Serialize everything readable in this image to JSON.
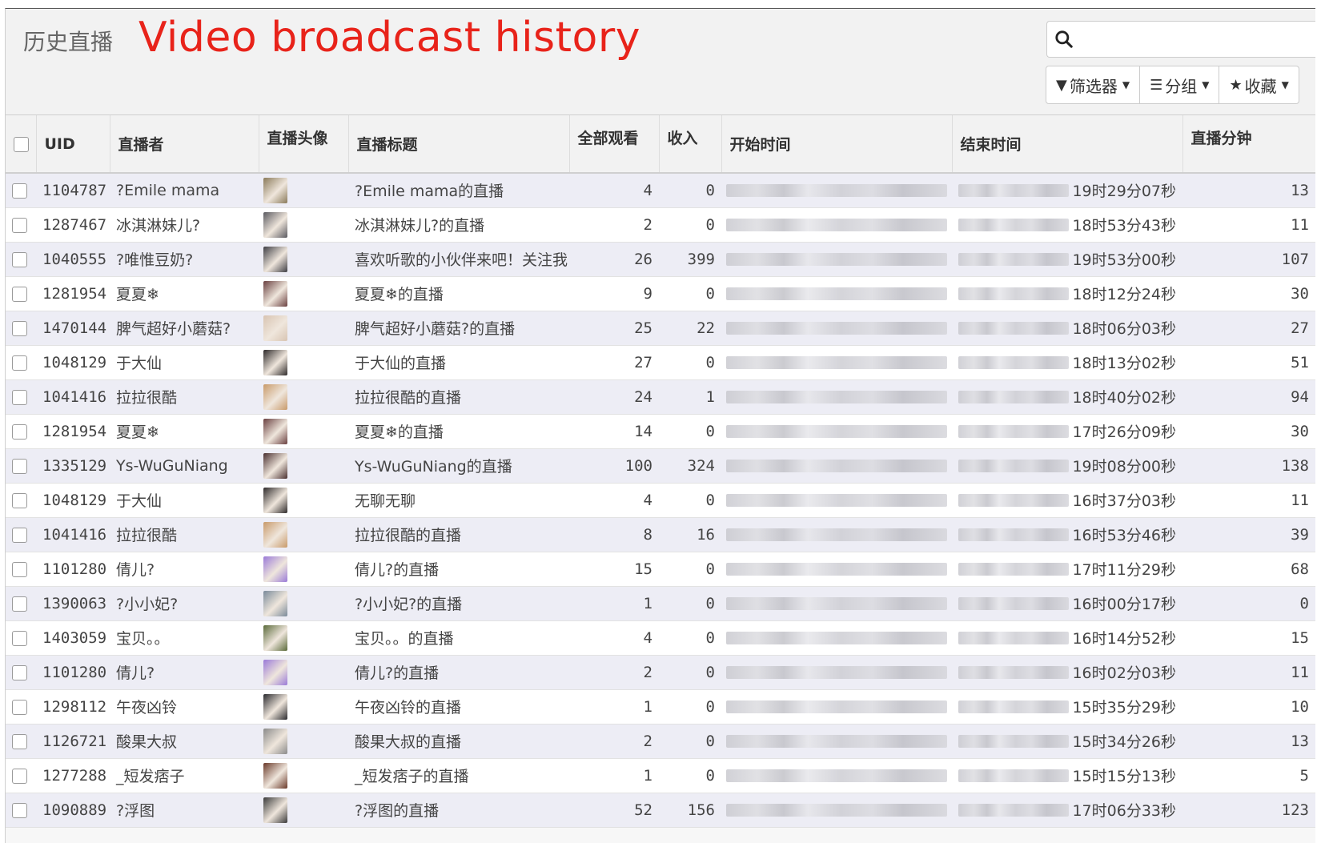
{
  "header": {
    "breadcrumb": "历史直播",
    "title": "Video broadcast history",
    "search": {
      "placeholder": ""
    },
    "buttons": [
      {
        "icon": "filter-icon",
        "label": "筛选器"
      },
      {
        "icon": "list-icon",
        "label": "分组"
      },
      {
        "icon": "star-icon",
        "label": "收藏"
      }
    ]
  },
  "table": {
    "columns": [
      "UID",
      "直播者",
      "直播头像",
      "直播标题",
      "全部观看",
      "收入",
      "开始时间",
      "结束时间",
      "直播分钟"
    ],
    "rows": [
      {
        "uid": "1104787",
        "streamer": "?Emile mama",
        "title": "?Emile mama的直播",
        "views": "4",
        "income": "0",
        "end": "19时29分07秒",
        "minutes": "13",
        "avatar_color": "#8a7a5a"
      },
      {
        "uid": "1287467",
        "streamer": "冰淇淋妹儿?",
        "title": "冰淇淋妹儿?的直播",
        "views": "2",
        "income": "0",
        "end": "18时53分43秒",
        "minutes": "11",
        "avatar_color": "#5a5a60"
      },
      {
        "uid": "1040555",
        "streamer": "?唯惟豆奶?",
        "title": "喜欢听歌的小伙伴来吧！关注我",
        "views": "26",
        "income": "399",
        "end": "19时53分00秒",
        "minutes": "107",
        "avatar_color": "#3e3e44"
      },
      {
        "uid": "1281954",
        "streamer": "夏夏❄",
        "title": "夏夏❄的直播",
        "views": "9",
        "income": "0",
        "end": "18时12分24秒",
        "minutes": "30",
        "avatar_color": "#6a4040"
      },
      {
        "uid": "1470144",
        "streamer": "脾气超好小蘑菇?",
        "title": "脾气超好小蘑菇?的直播",
        "views": "25",
        "income": "22",
        "end": "18时06分03秒",
        "minutes": "27",
        "avatar_color": "#d8c4b2"
      },
      {
        "uid": "1048129",
        "streamer": "于大仙",
        "title": "于大仙的直播",
        "views": "27",
        "income": "0",
        "end": "18时13分02秒",
        "minutes": "51",
        "avatar_color": "#2e2a2a"
      },
      {
        "uid": "1041416",
        "streamer": "拉拉很酷",
        "title": "拉拉很酷的直播",
        "views": "24",
        "income": "1",
        "end": "18时40分02秒",
        "minutes": "94",
        "avatar_color": "#c89a6a"
      },
      {
        "uid": "1281954",
        "streamer": "夏夏❄",
        "title": "夏夏❄的直播",
        "views": "14",
        "income": "0",
        "end": "17时26分09秒",
        "minutes": "30",
        "avatar_color": "#6a4040"
      },
      {
        "uid": "1335129",
        "streamer": "Ys-WuGuNiang",
        "title": "Ys-WuGuNiang的直播",
        "views": "100",
        "income": "324",
        "end": "19时08分00秒",
        "minutes": "138",
        "avatar_color": "#4a3030"
      },
      {
        "uid": "1048129",
        "streamer": "于大仙",
        "title": "无聊无聊",
        "views": "4",
        "income": "0",
        "end": "16时37分03秒",
        "minutes": "11",
        "avatar_color": "#2e2a2a"
      },
      {
        "uid": "1041416",
        "streamer": "拉拉很酷",
        "title": "拉拉很酷的直播",
        "views": "8",
        "income": "16",
        "end": "16时53分46秒",
        "minutes": "39",
        "avatar_color": "#c89a6a"
      },
      {
        "uid": "1101280",
        "streamer": "倩儿?",
        "title": "倩儿?的直播",
        "views": "15",
        "income": "0",
        "end": "17时11分29秒",
        "minutes": "68",
        "avatar_color": "#9a7ad8"
      },
      {
        "uid": "1390063",
        "streamer": "?小小妃?",
        "title": "?小小妃?的直播",
        "views": "1",
        "income": "0",
        "end": "16时00分17秒",
        "minutes": "0",
        "avatar_color": "#7a8a9a"
      },
      {
        "uid": "1403059",
        "streamer": "宝贝。。",
        "title": "宝贝。。的直播",
        "views": "4",
        "income": "0",
        "end": "16时14分52秒",
        "minutes": "15",
        "avatar_color": "#5a6a3a"
      },
      {
        "uid": "1101280",
        "streamer": "倩儿?",
        "title": "倩儿?的直播",
        "views": "2",
        "income": "0",
        "end": "16时02分03秒",
        "minutes": "11",
        "avatar_color": "#9a7ad8"
      },
      {
        "uid": "1298112",
        "streamer": "午夜凶铃",
        "title": "午夜凶铃的直播",
        "views": "1",
        "income": "0",
        "end": "15时35分29秒",
        "minutes": "10",
        "avatar_color": "#2a2a2e"
      },
      {
        "uid": "1126721",
        "streamer": "酸果大叔",
        "title": "酸果大叔的直播",
        "views": "2",
        "income": "0",
        "end": "15时34分26秒",
        "minutes": "13",
        "avatar_color": "#8a8a8a"
      },
      {
        "uid": "1277288",
        "streamer": "_短发痞子",
        "title": "_短发痞子的直播",
        "views": "1",
        "income": "0",
        "end": "15时15分13秒",
        "minutes": "5",
        "avatar_color": "#6a3a2a"
      },
      {
        "uid": "1090889",
        "streamer": "?浮图",
        "title": "?浮图的直播",
        "views": "52",
        "income": "156",
        "end": "17时06分33秒",
        "minutes": "123",
        "avatar_color": "#3a3a3a"
      }
    ]
  }
}
